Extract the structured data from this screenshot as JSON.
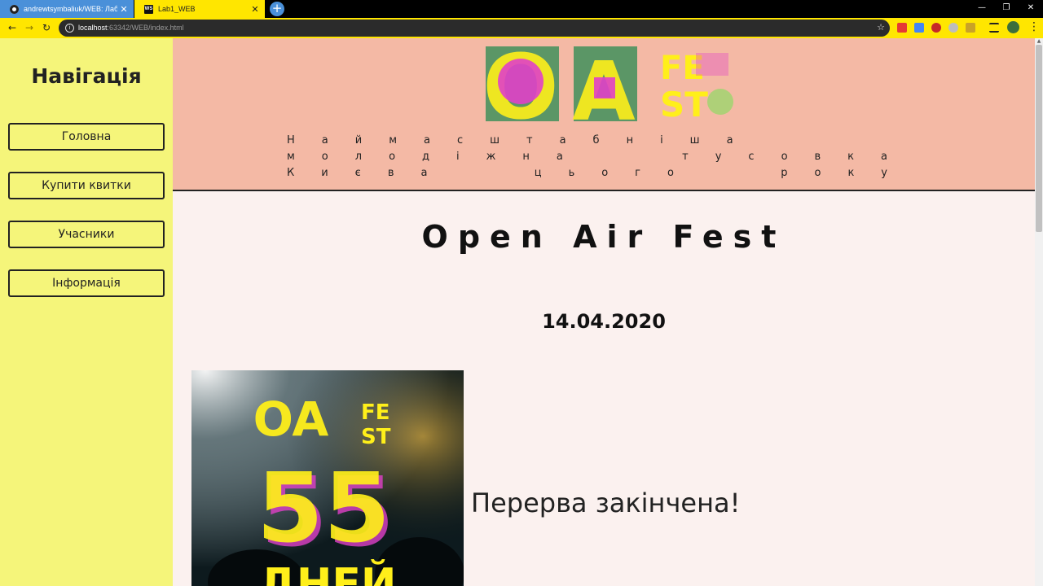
{
  "browser": {
    "tabs": [
      {
        "title": "andrewtsymbaliuk/WEB: Лабора",
        "favicon": "github-icon"
      },
      {
        "title": "Lab1_WEB",
        "favicon": "webstorm-icon"
      }
    ],
    "url_host": "localhost",
    "url_rest": ":63342/WEB/index.html",
    "accent": "#ffe600"
  },
  "sidebar": {
    "title": "Навігація",
    "items": [
      {
        "label": "Головна"
      },
      {
        "label": "Купити квитки"
      },
      {
        "label": "Учасники"
      },
      {
        "label": "Інформація"
      }
    ],
    "background": "#f5f57a"
  },
  "hero": {
    "logo_letters": {
      "big": "OA",
      "small_top": "FE",
      "small_bottom": "ST"
    },
    "tagline": "Наймасштабніша молодіжна тусовка Києва цього року",
    "background": "#f4b9a5"
  },
  "main": {
    "title": "Open Air Fest",
    "date": "14.04.2020",
    "poster": {
      "logo_big": "OA",
      "logo_small_top": "FE",
      "logo_small_bottom": "ST",
      "number": "55",
      "word": "ДНЕЙ"
    },
    "status": "Перерва закінчена!",
    "background": "#fbf1ef"
  }
}
